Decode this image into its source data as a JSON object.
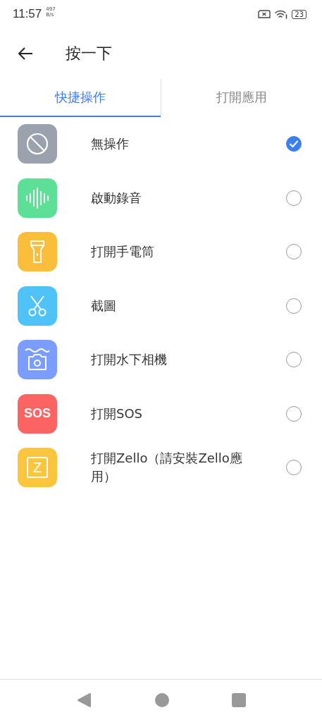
{
  "status_bar": {
    "time": "11:57",
    "speed_value": "497",
    "speed_unit": "B/s",
    "battery": "23"
  },
  "header": {
    "title": "按一下"
  },
  "tabs": [
    {
      "label": "快捷操作",
      "selected": true
    },
    {
      "label": "打開應用",
      "selected": false
    }
  ],
  "options": [
    {
      "label": "無操作",
      "kind": "none",
      "color": "#9ba1ad",
      "selected": true
    },
    {
      "label": "啟動錄音",
      "kind": "record",
      "color": "#5ddf98",
      "selected": false
    },
    {
      "label": "打開手電筒",
      "kind": "flashlight",
      "color": "#fbbe3a",
      "selected": false
    },
    {
      "label": "截圖",
      "kind": "screenshot",
      "color": "#4fc3f7",
      "selected": false
    },
    {
      "label": "打開水下相機",
      "kind": "camera",
      "color": "#7b9dff",
      "selected": false
    },
    {
      "label": "打開SOS",
      "kind": "text",
      "icon_text": "SOS",
      "color": "#fb6463",
      "selected": false
    },
    {
      "label": "打開Zello（請安裝Zello應用）",
      "kind": "chat",
      "icon_text": "Z",
      "color": "#fbc63c",
      "selected": false
    }
  ]
}
